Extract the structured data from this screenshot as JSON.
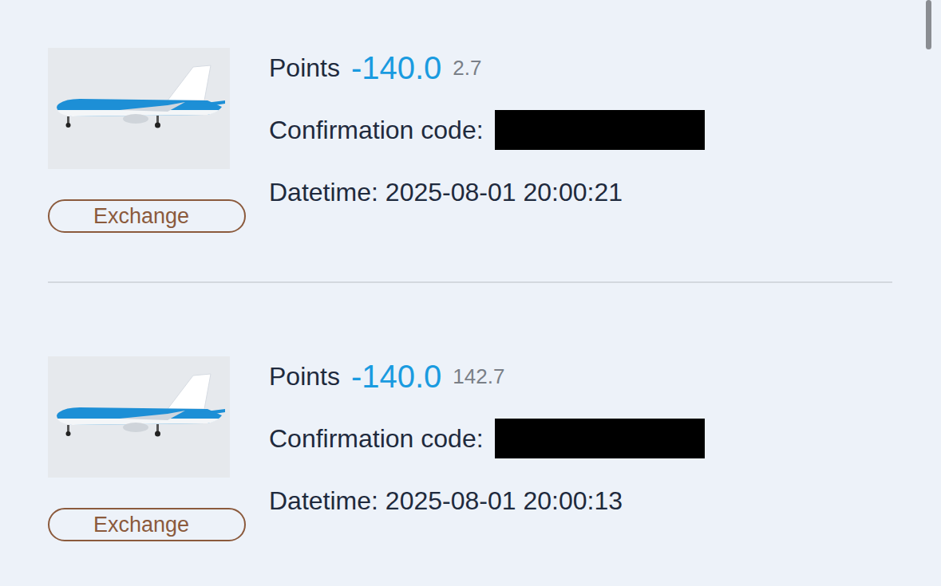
{
  "records": [
    {
      "points_label": "Points",
      "points": "-140.0",
      "balance": "2.7",
      "confirmation_label": "Confirmation code:",
      "confirmation_redacted": true,
      "datetime": "Datetime: 2025-08-01 20:00:21",
      "button": "Exchange"
    },
    {
      "points_label": "Points",
      "points": "-140.0",
      "balance": "142.7",
      "confirmation_label": "Confirmation code:",
      "confirmation_redacted": true,
      "datetime": "Datetime: 2025-08-01 20:00:13",
      "button": "Exchange"
    }
  ]
}
